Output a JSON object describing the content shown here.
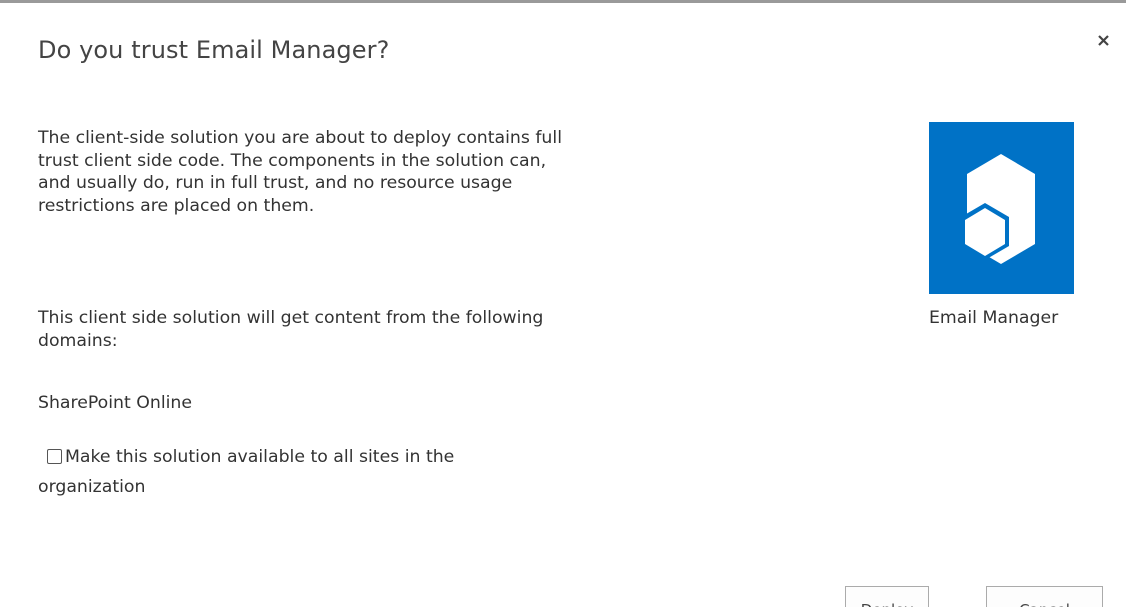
{
  "dialog": {
    "title": "Do you trust Email Manager?",
    "close_icon": "close-icon"
  },
  "body": {
    "paragraph1": "The client-side solution you are about to deploy contains full trust client side code. The components in the solution can, and usually do, run in full trust, and no resource usage restrictions are placed on them.",
    "paragraph2": "This client side solution will get content from the following domains:",
    "domain": "SharePoint Online",
    "checkbox_label": "Make this solution available to all sites in the organization",
    "checkbox_checked": false
  },
  "app": {
    "name": "Email Manager",
    "icon": "app-package-icon",
    "tile_color": "#0072c6"
  },
  "buttons": {
    "deploy": "Deploy",
    "cancel": "Cancel"
  }
}
